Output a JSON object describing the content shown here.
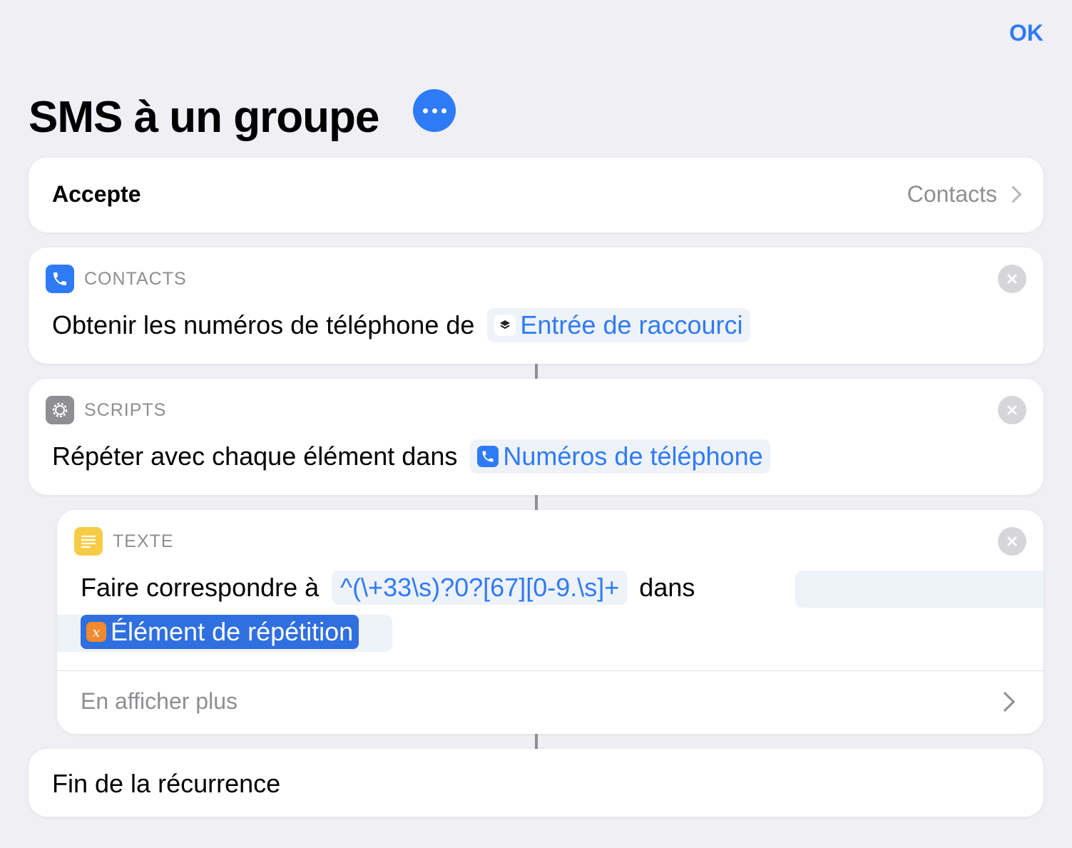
{
  "header": {
    "ok_label": "OK",
    "title": "SMS à un groupe",
    "more_icon": "ellipsis-icon"
  },
  "accepts": {
    "label": "Accepte",
    "value": "Contacts"
  },
  "actions": {
    "contacts": {
      "category": "CONTACTS",
      "text": "Obtenir les numéros de téléphone de",
      "token": "Entrée de raccourci",
      "icon": "phone-icon",
      "icon_color": "#2f7bf5"
    },
    "scripts": {
      "category": "SCRIPTS",
      "text": "Répéter avec chaque élément dans",
      "token": "Numéros de téléphone",
      "icon": "gear-icon",
      "icon_color": "#8e8e93"
    },
    "texte": {
      "category": "TEXTE",
      "text_prefix": "Faire correspondre à",
      "pattern": "^(\\+33\\s)?0?[67][0-9.\\s]+",
      "text_mid": "dans",
      "token": "Élément de répétition",
      "show_more": "En afficher plus",
      "icon": "text-icon",
      "icon_color": "#f7cc45"
    },
    "end": {
      "text": "Fin de la récurrence"
    }
  },
  "colors": {
    "accent": "#2f7bf5",
    "background": "#efeff4"
  }
}
